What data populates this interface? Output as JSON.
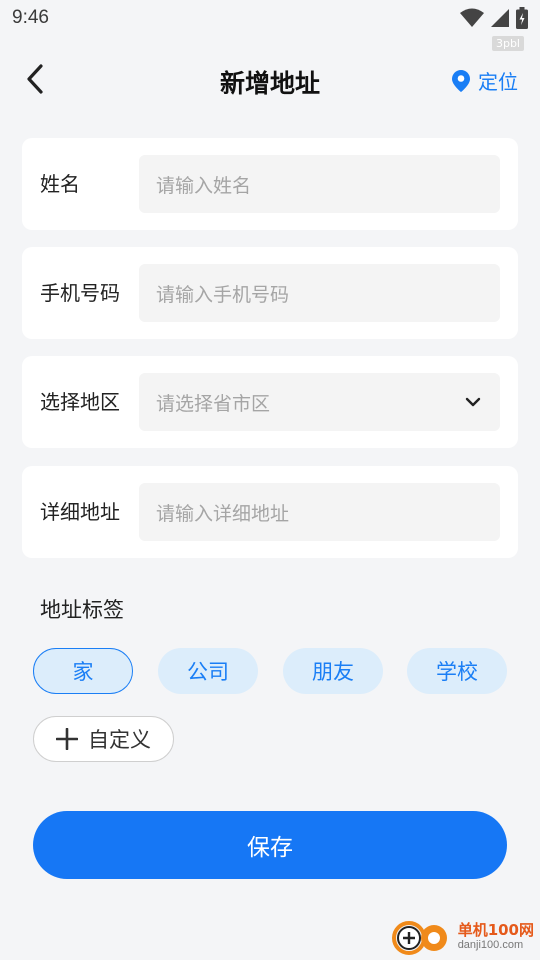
{
  "status_bar": {
    "time": "9:46"
  },
  "watermark_top": "3pbl",
  "nav": {
    "title": "新增地址",
    "locate_label": "定位"
  },
  "form": {
    "name": {
      "label": "姓名",
      "placeholder": "请输入姓名"
    },
    "phone": {
      "label": "手机号码",
      "placeholder": "请输入手机号码"
    },
    "region": {
      "label": "选择地区",
      "placeholder": "请选择省市区"
    },
    "detail": {
      "label": "详细地址",
      "placeholder": "请输入详细地址"
    }
  },
  "tags": {
    "title": "地址标签",
    "items": [
      {
        "label": "家",
        "selected": true
      },
      {
        "label": "公司",
        "selected": false
      },
      {
        "label": "朋友",
        "selected": false
      },
      {
        "label": "学校",
        "selected": false
      }
    ],
    "custom_label": "自定义"
  },
  "save_label": "保存",
  "branding": {
    "name": "单机100网",
    "url": "danji100.com"
  },
  "colors": {
    "accent": "#1677f5",
    "tag_bg": "#dcedfb",
    "page_bg": "#f4f5f7"
  }
}
